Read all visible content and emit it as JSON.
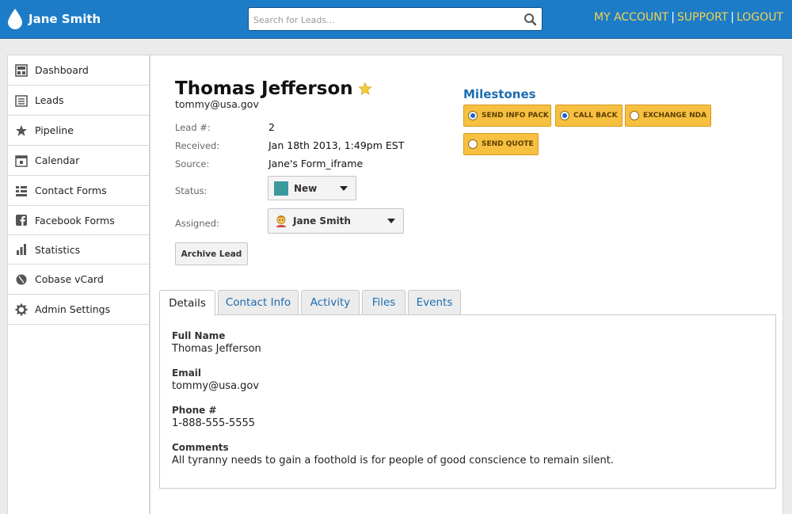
{
  "header": {
    "brand_name": "Jane Smith",
    "search_placeholder": "Search for Leads...",
    "links": {
      "my_account": "MY ACCOUNT",
      "support": "SUPPORT",
      "logout": "LOGOUT"
    },
    "separator": "|",
    "colors": {
      "bar": "#1d7cc8",
      "link": "#f2d34e"
    }
  },
  "sidebar": {
    "items": [
      {
        "label": "Dashboard",
        "icon": "dashboard-icon"
      },
      {
        "label": "Leads",
        "icon": "leads-icon"
      },
      {
        "label": "Pipeline",
        "icon": "pipeline-icon"
      },
      {
        "label": "Calendar",
        "icon": "calendar-icon"
      },
      {
        "label": "Contact Forms",
        "icon": "contact-forms-icon"
      },
      {
        "label": "Facebook Forms",
        "icon": "facebook-icon"
      },
      {
        "label": "Statistics",
        "icon": "statistics-icon"
      },
      {
        "label": "Cobase vCard",
        "icon": "globe-icon"
      },
      {
        "label": "Admin Settings",
        "icon": "gear-icon"
      }
    ]
  },
  "lead": {
    "name": "Thomas Jefferson",
    "email": "tommy@usa.gov",
    "fields": {
      "lead_num_label": "Lead #:",
      "lead_num": "2",
      "received_label": "Received:",
      "received": "Jan 18th 2013, 1:49pm EST",
      "source_label": "Source:",
      "source": "Jane's Form_iframe",
      "status_label": "Status:",
      "status": "New",
      "assigned_label": "Assigned:",
      "assigned": "Jane Smith"
    },
    "status_color": "#3b9a9c",
    "archive_label": "Archive Lead"
  },
  "milestones": {
    "title": "Milestones",
    "items": [
      {
        "label": "SEND INFO PACK",
        "checked": true
      },
      {
        "label": "CALL BACK",
        "checked": true
      },
      {
        "label": "EXCHANGE NDA",
        "checked": false
      },
      {
        "label": "SEND QUOTE",
        "checked": false
      }
    ],
    "color": "#f7c040"
  },
  "tabs": [
    "Details",
    "Contact Info",
    "Activity",
    "Files",
    "Events"
  ],
  "active_tab": "Details",
  "details": {
    "full_name_label": "Full Name",
    "full_name": "Thomas Jefferson",
    "email_label": "Email",
    "email": "tommy@usa.gov",
    "phone_label": "Phone #",
    "phone": "1-888-555-5555",
    "comments_label": "Comments",
    "comments": "All tyranny needs to gain a foothold is for people of good conscience to remain silent."
  }
}
